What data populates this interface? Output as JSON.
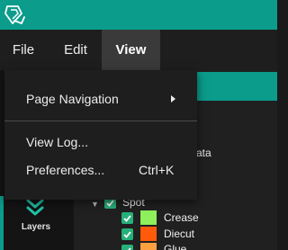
{
  "menubar": {
    "file": "File",
    "edit": "Edit",
    "view": "View"
  },
  "view_menu": {
    "items": [
      {
        "label": "Page Navigation",
        "has_submenu": true
      },
      {
        "label": "View Log..."
      },
      {
        "label": "Preferences...",
        "shortcut": "Ctrl+K"
      }
    ]
  },
  "sidebar": {
    "layers_label": "Layers",
    "layers_icon": "chevrons-down-icon"
  },
  "layers_panel": {
    "partial_text": "ata",
    "group": "Spot",
    "layers": [
      {
        "name": "Crease",
        "color": "#8ef05a"
      },
      {
        "name": "Diecut",
        "color": "#ff5a0a"
      },
      {
        "name": "Glue",
        "color": "#ffa040"
      }
    ]
  },
  "colors": {
    "accent": "#0b9c8b",
    "checkbox": "#27b07a"
  }
}
